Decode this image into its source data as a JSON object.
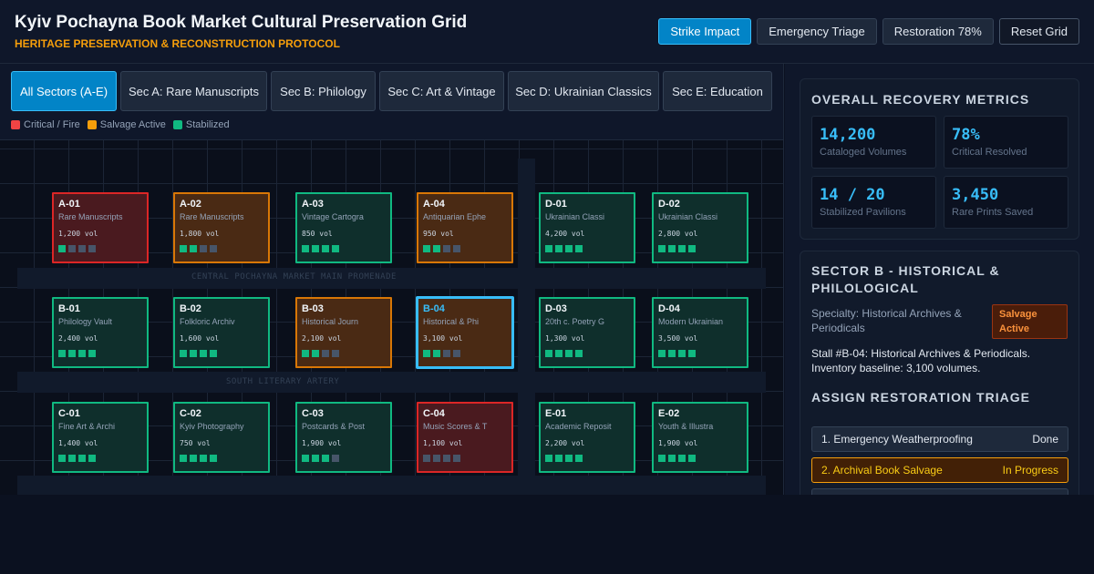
{
  "header": {
    "title": "Kyiv Pochayna Book Market Cultural Preservation Grid",
    "subtitle": "HERITAGE PRESERVATION & RECONSTRUCTION PROTOCOL",
    "buttons": [
      {
        "label": "Strike Impact",
        "style": "primary"
      },
      {
        "label": "Emergency Triage",
        "style": "default"
      },
      {
        "label": "Restoration 78%",
        "style": "default"
      },
      {
        "label": "Reset Grid",
        "style": "outline"
      }
    ]
  },
  "tabs": [
    {
      "label": "All Sectors (A-E)",
      "active": true
    },
    {
      "label": "Sec A: Rare Manuscripts",
      "active": false
    },
    {
      "label": "Sec B: Philology",
      "active": false
    },
    {
      "label": "Sec C: Art & Vintage",
      "active": false
    },
    {
      "label": "Sec D: Ukrainian Classics",
      "active": false
    },
    {
      "label": "Sec E: Education",
      "active": false
    }
  ],
  "legend": [
    {
      "label": "Critical / Fire",
      "color": "#ef4444"
    },
    {
      "label": "Salvage Active",
      "color": "#f59e0b"
    },
    {
      "label": "Stabilized",
      "color": "#10b981"
    }
  ],
  "roads": {
    "promenade": "CENTRAL POCHAYNA MARKET MAIN PROMENADE",
    "artery": "SOUTH LITERARY ARTERY"
  },
  "stalls": [
    {
      "id": "A-01",
      "name": "Rare Manuscripts",
      "volumes": "1,200 vol",
      "status": "critical",
      "bars": 1,
      "selected": false
    },
    {
      "id": "A-02",
      "name": "Rare Manuscripts",
      "volumes": "1,800 vol",
      "status": "salvage",
      "bars": 2,
      "selected": false
    },
    {
      "id": "A-03",
      "name": "Vintage Cartogra",
      "volumes": "850 vol",
      "status": "stable",
      "bars": 4,
      "selected": false
    },
    {
      "id": "A-04",
      "name": "Antiquarian Ephe",
      "volumes": "950 vol",
      "status": "salvage",
      "bars": 2,
      "selected": false
    },
    {
      "id": "D-01",
      "name": "Ukrainian Classi",
      "volumes": "4,200 vol",
      "status": "stable",
      "bars": 4,
      "selected": false
    },
    {
      "id": "D-02",
      "name": "Ukrainian Classi",
      "volumes": "2,800 vol",
      "status": "stable",
      "bars": 4,
      "selected": false
    },
    {
      "id": "B-01",
      "name": "Philology Vault",
      "volumes": "2,400 vol",
      "status": "stable",
      "bars": 4,
      "selected": false
    },
    {
      "id": "B-02",
      "name": "Folkloric Archiv",
      "volumes": "1,600 vol",
      "status": "stable",
      "bars": 4,
      "selected": false
    },
    {
      "id": "B-03",
      "name": "Historical Journ",
      "volumes": "2,100 vol",
      "status": "salvage",
      "bars": 2,
      "selected": false
    },
    {
      "id": "B-04",
      "name": "Historical & Phi",
      "volumes": "3,100 vol",
      "status": "salvage",
      "bars": 2,
      "selected": true
    },
    {
      "id": "D-03",
      "name": "20th c. Poetry G",
      "volumes": "1,300 vol",
      "status": "stable",
      "bars": 4,
      "selected": false
    },
    {
      "id": "D-04",
      "name": "Modern Ukrainian",
      "volumes": "3,500 vol",
      "status": "stable",
      "bars": 4,
      "selected": false
    },
    {
      "id": "C-01",
      "name": "Fine Art & Archi",
      "volumes": "1,400 vol",
      "status": "stable",
      "bars": 4,
      "selected": false
    },
    {
      "id": "C-02",
      "name": "Kyiv Photography",
      "volumes": "750 vol",
      "status": "stable",
      "bars": 4,
      "selected": false
    },
    {
      "id": "C-03",
      "name": "Postcards & Post",
      "volumes": "1,900 vol",
      "status": "stable",
      "bars": 3,
      "selected": false
    },
    {
      "id": "C-04",
      "name": "Music Scores & T",
      "volumes": "1,100 vol",
      "status": "critical",
      "bars": 0,
      "selected": false
    },
    {
      "id": "E-01",
      "name": "Academic Reposit",
      "volumes": "2,200 vol",
      "status": "stable",
      "bars": 4,
      "selected": false
    },
    {
      "id": "E-02",
      "name": "Youth & Illustra",
      "volumes": "1,900 vol",
      "status": "stable",
      "bars": 4,
      "selected": false
    }
  ],
  "metrics": {
    "title": "OVERALL RECOVERY METRICS",
    "items": [
      {
        "value": "14,200",
        "label": "Cataloged Volumes"
      },
      {
        "value": "78%",
        "label": "Critical Resolved"
      },
      {
        "value": "14 / 20",
        "label": "Stabilized Pavilions"
      },
      {
        "value": "3,450",
        "label": "Rare Prints Saved"
      }
    ]
  },
  "sector": {
    "title": "SECTOR B - HISTORICAL & PHILOLOGICAL",
    "specialty": "Specialty: Historical Archives & Periodicals",
    "badge": "Salvage Active",
    "stall_desc": "Stall #B-04: Historical Archives & Periodicals. Inventory baseline: 3,100 volumes.",
    "triage_title": "ASSIGN RESTORATION TRIAGE",
    "triage": [
      {
        "label": "1. Emergency Weatherproofing",
        "status": "Done",
        "state": "done"
      },
      {
        "label": "2. Archival Book Salvage",
        "status": "In Progress",
        "state": "progress"
      }
    ]
  }
}
